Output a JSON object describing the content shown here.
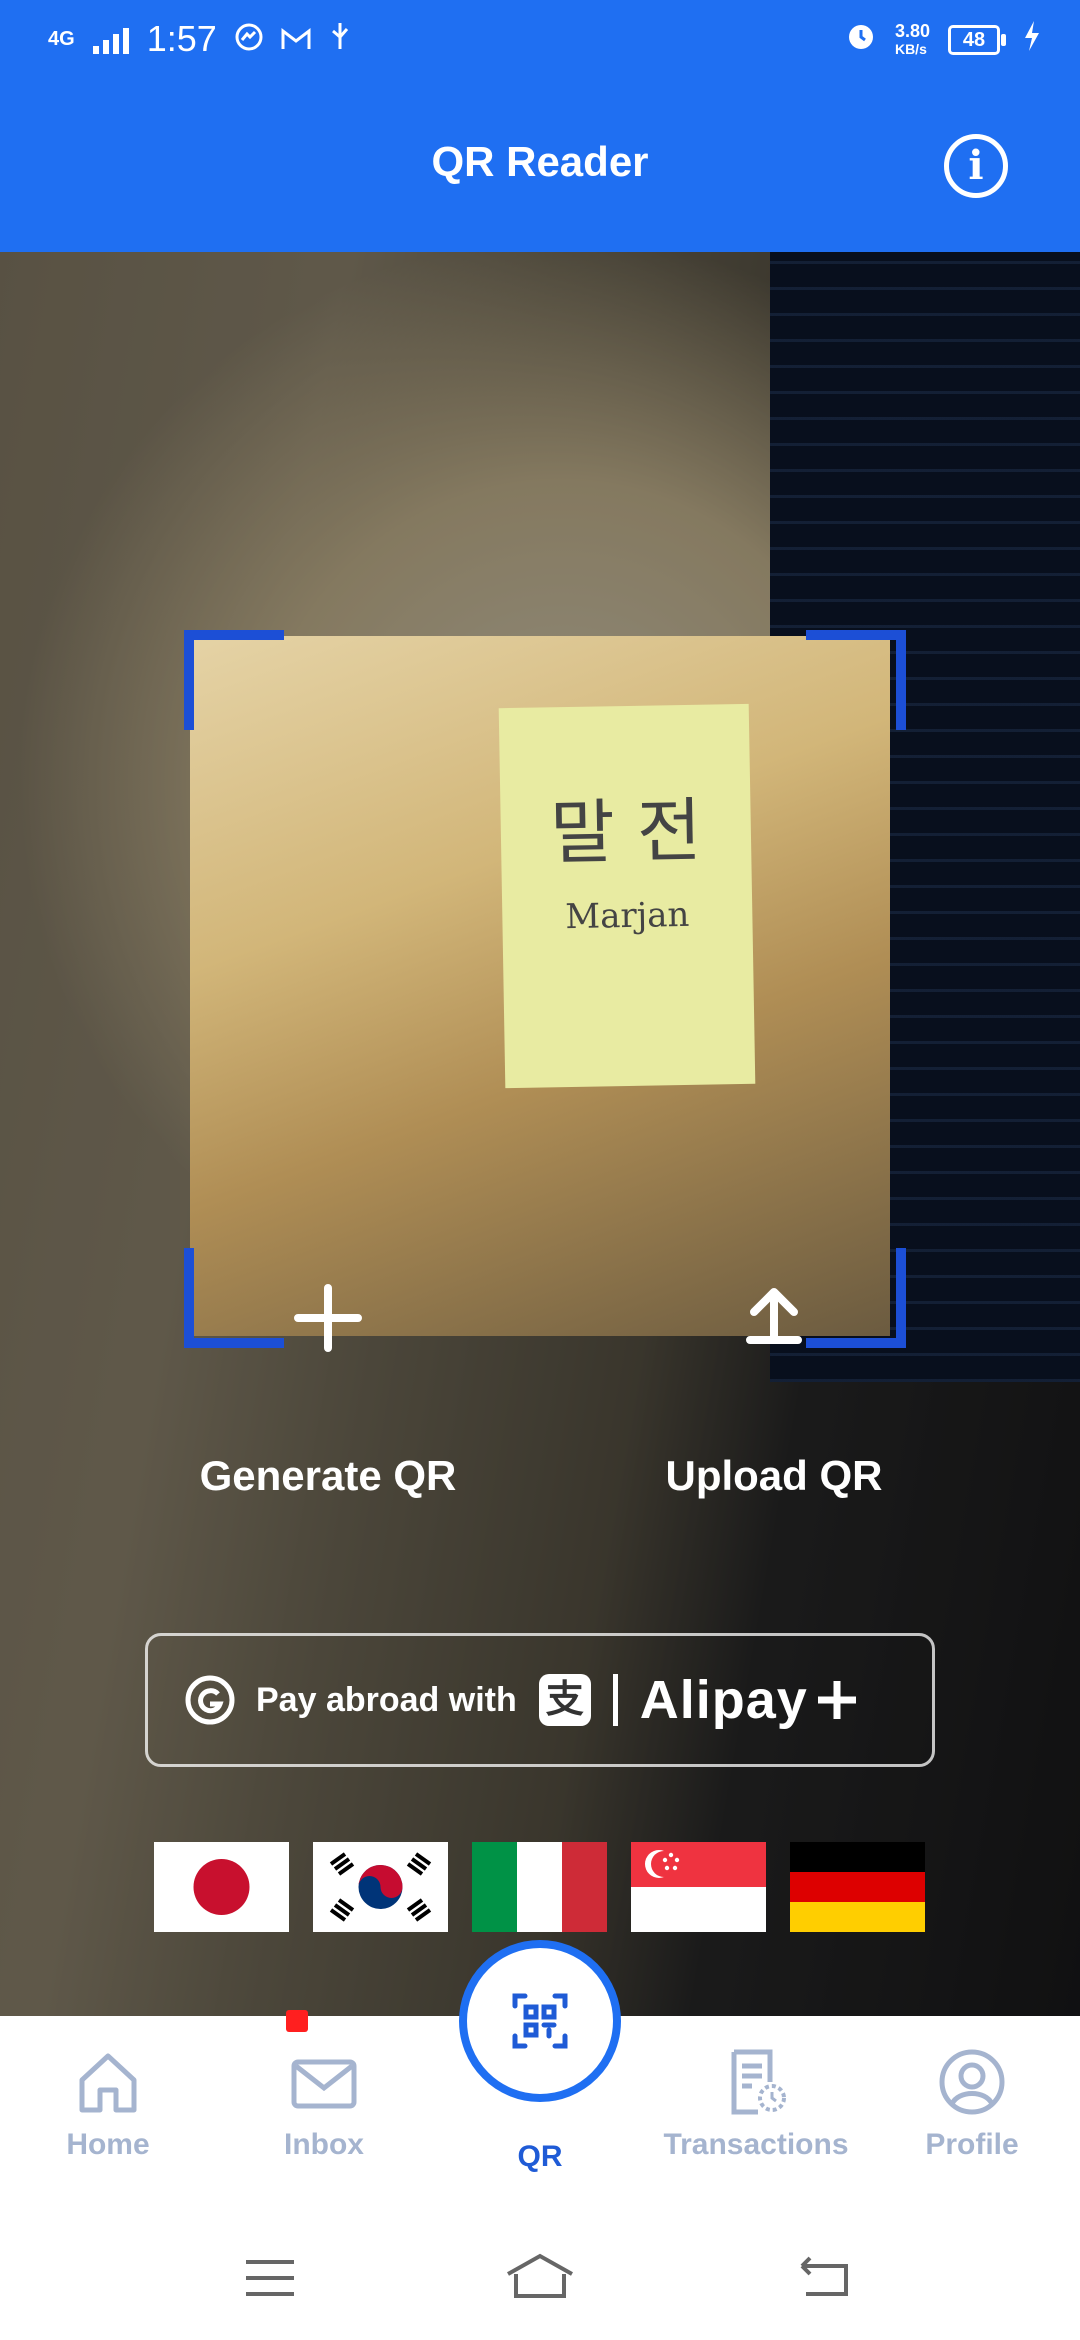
{
  "status_bar": {
    "network": "4G",
    "time": "1:57",
    "speed_value": "3.80",
    "speed_unit": "KB/s",
    "battery": "48"
  },
  "header": {
    "title": "QR Reader",
    "info_icon": "info-icon"
  },
  "camera": {
    "note_line1": "말 전",
    "note_line2": "Marjan"
  },
  "actions": {
    "generate_label": "Generate QR",
    "upload_label": "Upload QR"
  },
  "alipay": {
    "text": "Pay abroad with",
    "brand": "Alipay",
    "zhi": "支"
  },
  "flags": [
    "Japan",
    "South Korea",
    "Italy",
    "Singapore",
    "Germany"
  ],
  "bottom_nav": {
    "items": [
      {
        "label": "Home",
        "icon": "home-icon"
      },
      {
        "label": "Inbox",
        "icon": "inbox-icon"
      },
      {
        "label": "QR",
        "icon": "qr-scan-icon"
      },
      {
        "label": "Transactions",
        "icon": "transactions-icon"
      },
      {
        "label": "Profile",
        "icon": "profile-icon"
      }
    ],
    "active": "QR"
  },
  "colors": {
    "brand_blue": "#1f6ff2",
    "corner_blue": "#1c4fd6",
    "nav_inactive": "#a5b4cf"
  }
}
